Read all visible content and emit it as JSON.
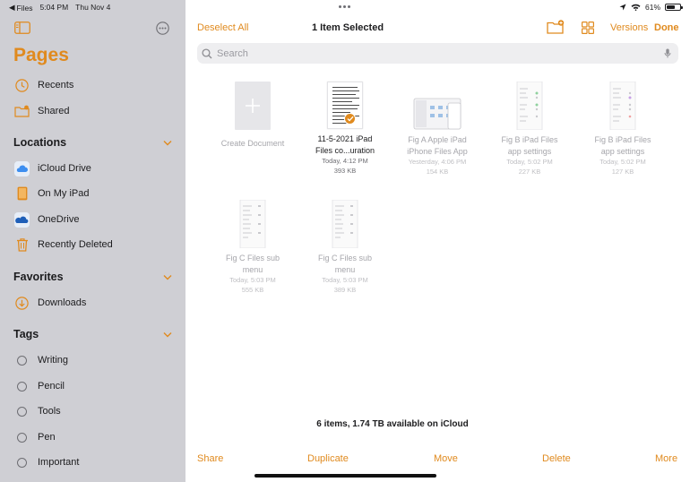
{
  "status": {
    "back_app": "Files",
    "time": "5:04 PM",
    "date": "Thu Nov 4",
    "battery": "61%"
  },
  "sidebar": {
    "title": "Pages",
    "top_items": [
      {
        "label": "Recents",
        "icon": "clock-icon"
      },
      {
        "label": "Shared",
        "icon": "shared-folder-icon"
      }
    ],
    "sections": [
      {
        "title": "Locations",
        "items": [
          {
            "label": "iCloud Drive",
            "icon": "icloud-icon"
          },
          {
            "label": "On My iPad",
            "icon": "ipad-icon"
          },
          {
            "label": "OneDrive",
            "icon": "onedrive-icon"
          },
          {
            "label": "Recently Deleted",
            "icon": "trash-icon"
          }
        ]
      },
      {
        "title": "Favorites",
        "items": [
          {
            "label": "Downloads",
            "icon": "download-icon"
          }
        ]
      },
      {
        "title": "Tags",
        "items": [
          {
            "label": "Writing"
          },
          {
            "label": "Pencil"
          },
          {
            "label": "Tools"
          },
          {
            "label": "Pen"
          },
          {
            "label": "Important"
          }
        ]
      }
    ]
  },
  "toolbar": {
    "deselect": "Deselect All",
    "title": "1 Item Selected",
    "versions": "Versions",
    "done": "Done"
  },
  "search": {
    "placeholder": "Search",
    "value": ""
  },
  "files": [
    {
      "name_line1": "Create Document",
      "name_line2": "",
      "date": "",
      "size": "",
      "type": "create"
    },
    {
      "name_line1": "11-5-2021 iPad",
      "name_line2": "Files co...uration",
      "date": "Today, 4:12 PM",
      "size": "393 KB",
      "type": "doc",
      "selected": true
    },
    {
      "name_line1": "Fig A Apple iPad",
      "name_line2": "iPhone Files App",
      "date": "Yesterday, 4:06 PM",
      "size": "154 KB",
      "type": "screenshot-landscape"
    },
    {
      "name_line1": "Fig B iPad Files",
      "name_line2": "app settings",
      "date": "Today, 5:02 PM",
      "size": "227 KB",
      "type": "screenshot-portrait"
    },
    {
      "name_line1": "Fig B iPad Files",
      "name_line2": "app settings",
      "date": "Today, 5:02 PM",
      "size": "127 KB",
      "type": "screenshot-portrait"
    },
    {
      "name_line1": "Fig C Files sub",
      "name_line2": "menu",
      "date": "Today, 5:03 PM",
      "size": "555 KB",
      "type": "screenshot-portrait"
    },
    {
      "name_line1": "Fig C Files sub",
      "name_line2": "menu",
      "date": "Today, 5:03 PM",
      "size": "389 KB",
      "type": "screenshot-portrait"
    }
  ],
  "footer": {
    "info": "6 items, 1.74 TB available on iCloud"
  },
  "bottom_actions": {
    "share": "Share",
    "duplicate": "Duplicate",
    "move": "Move",
    "delete": "Delete",
    "more": "More"
  },
  "colors": {
    "accent": "#e08a1e",
    "sidebar_bg": "#cfcfd4"
  }
}
